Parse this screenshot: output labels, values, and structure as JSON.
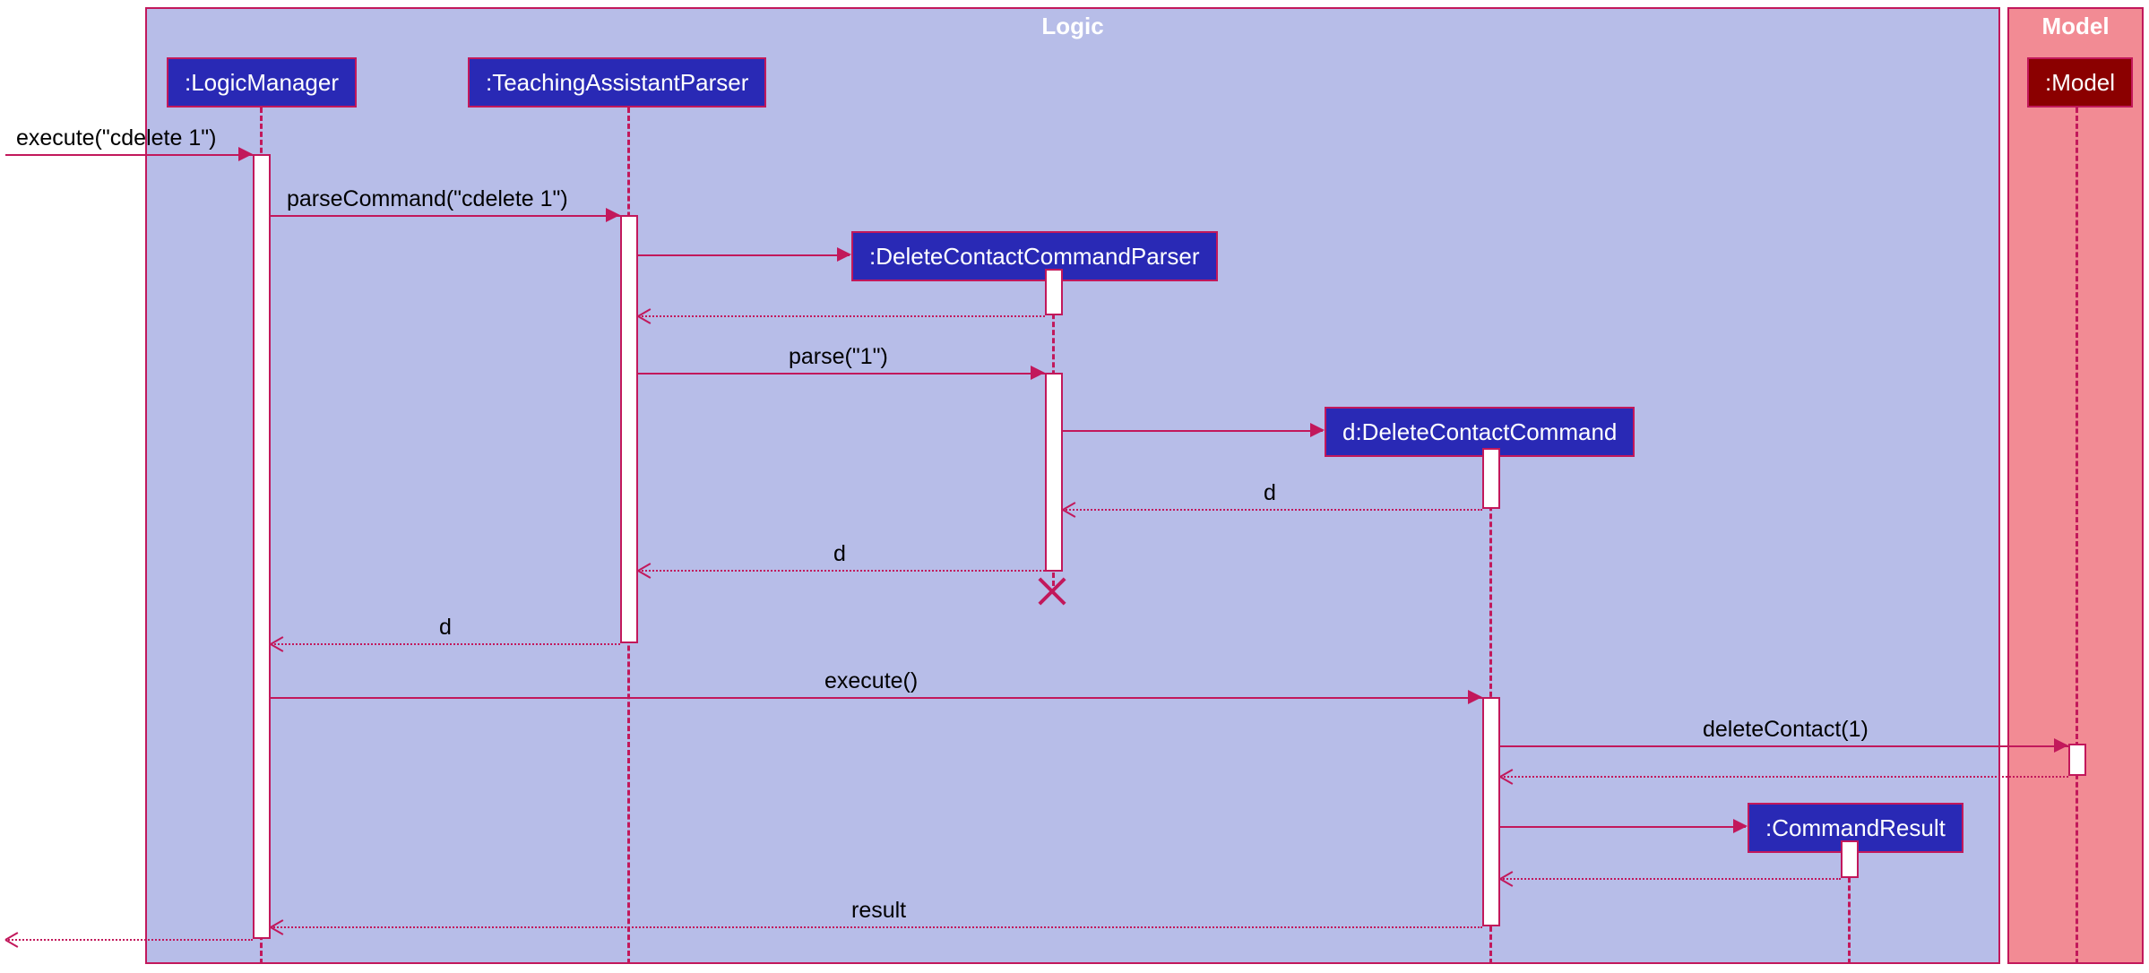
{
  "regions": {
    "logic": {
      "title": "Logic"
    },
    "model": {
      "title": "Model"
    }
  },
  "participants": {
    "logicManager": ":LogicManager",
    "parser": ":TeachingAssistantParser",
    "dccParser": ":DeleteContactCommandParser",
    "dcc": "d:DeleteContactCommand",
    "model": ":Model",
    "commandResult": ":CommandResult"
  },
  "messages": {
    "execute1": "execute(\"cdelete 1\")",
    "parseCommand": "parseCommand(\"cdelete 1\")",
    "parse": "parse(\"1\")",
    "d1": "d",
    "d2": "d",
    "d3": "d",
    "execute2": "execute()",
    "deleteContact": "deleteContact(1)",
    "result": "result"
  }
}
